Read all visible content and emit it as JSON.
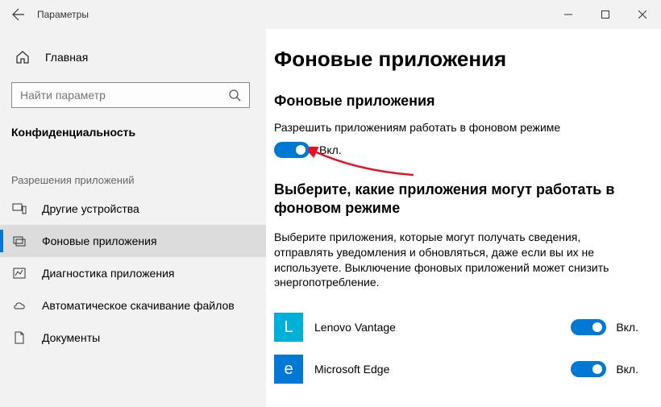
{
  "window": {
    "title": "Параметры"
  },
  "sidebar": {
    "home": "Главная",
    "search_placeholder": "Найти параметр",
    "sub_heading": "Конфиденциальность",
    "group_heading": "Разрешения приложений",
    "items": {
      "other_devices": "Другие устройства",
      "background_apps": "Фоновые приложения",
      "app_diagnostics": "Диагностика приложения",
      "auto_download": "Автоматическое скачивание файлов",
      "documents": "Документы"
    }
  },
  "main": {
    "heading": "Фоновые приложения",
    "section1_title": "Фоновые приложения",
    "section1_desc": "Разрешить приложениям работать в фоновом режиме",
    "toggle_label_on": "Вкл.",
    "section2_title": "Выберите, какие приложения могут работать в фоновом режиме",
    "section2_desc": "Выберите приложения, которые могут получать сведения, отправлять уведомления и обновляться, даже если вы их не используете. Выключение фоновых приложений может снизить энергопотребление.",
    "apps": [
      {
        "name": "Lenovo Vantage",
        "icon_letter": "L",
        "icon_color": "#00B0D8",
        "state": "Вкл."
      },
      {
        "name": "Microsoft Edge",
        "icon_letter": "e",
        "icon_color": "#0078D4",
        "state": "Вкл."
      }
    ]
  }
}
